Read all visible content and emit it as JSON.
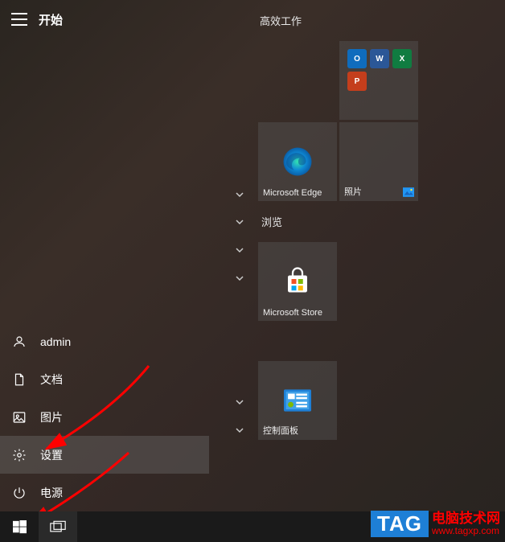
{
  "header": {
    "start_label": "开始"
  },
  "left_items": {
    "user": "admin",
    "documents": "文档",
    "pictures": "图片",
    "settings": "设置",
    "power": "电源"
  },
  "right": {
    "group1_label": "高效工作",
    "browse_label": "浏览",
    "tiles": {
      "edge": "Microsoft Edge",
      "photos": "照片",
      "store": "Microsoft Store",
      "control_panel": "控制面板"
    }
  },
  "office_apps": {
    "outlook": {
      "letter": "O",
      "bg": "#0f6cbd"
    },
    "word": {
      "letter": "W",
      "bg": "#2b5797"
    },
    "excel": {
      "letter": "X",
      "bg": "#107c41"
    },
    "powerpoint": {
      "letter": "P",
      "bg": "#c43e1c"
    }
  },
  "watermark": {
    "tag": "TAG",
    "cn": "电脑技术网",
    "url": "www.tagxp.com"
  }
}
